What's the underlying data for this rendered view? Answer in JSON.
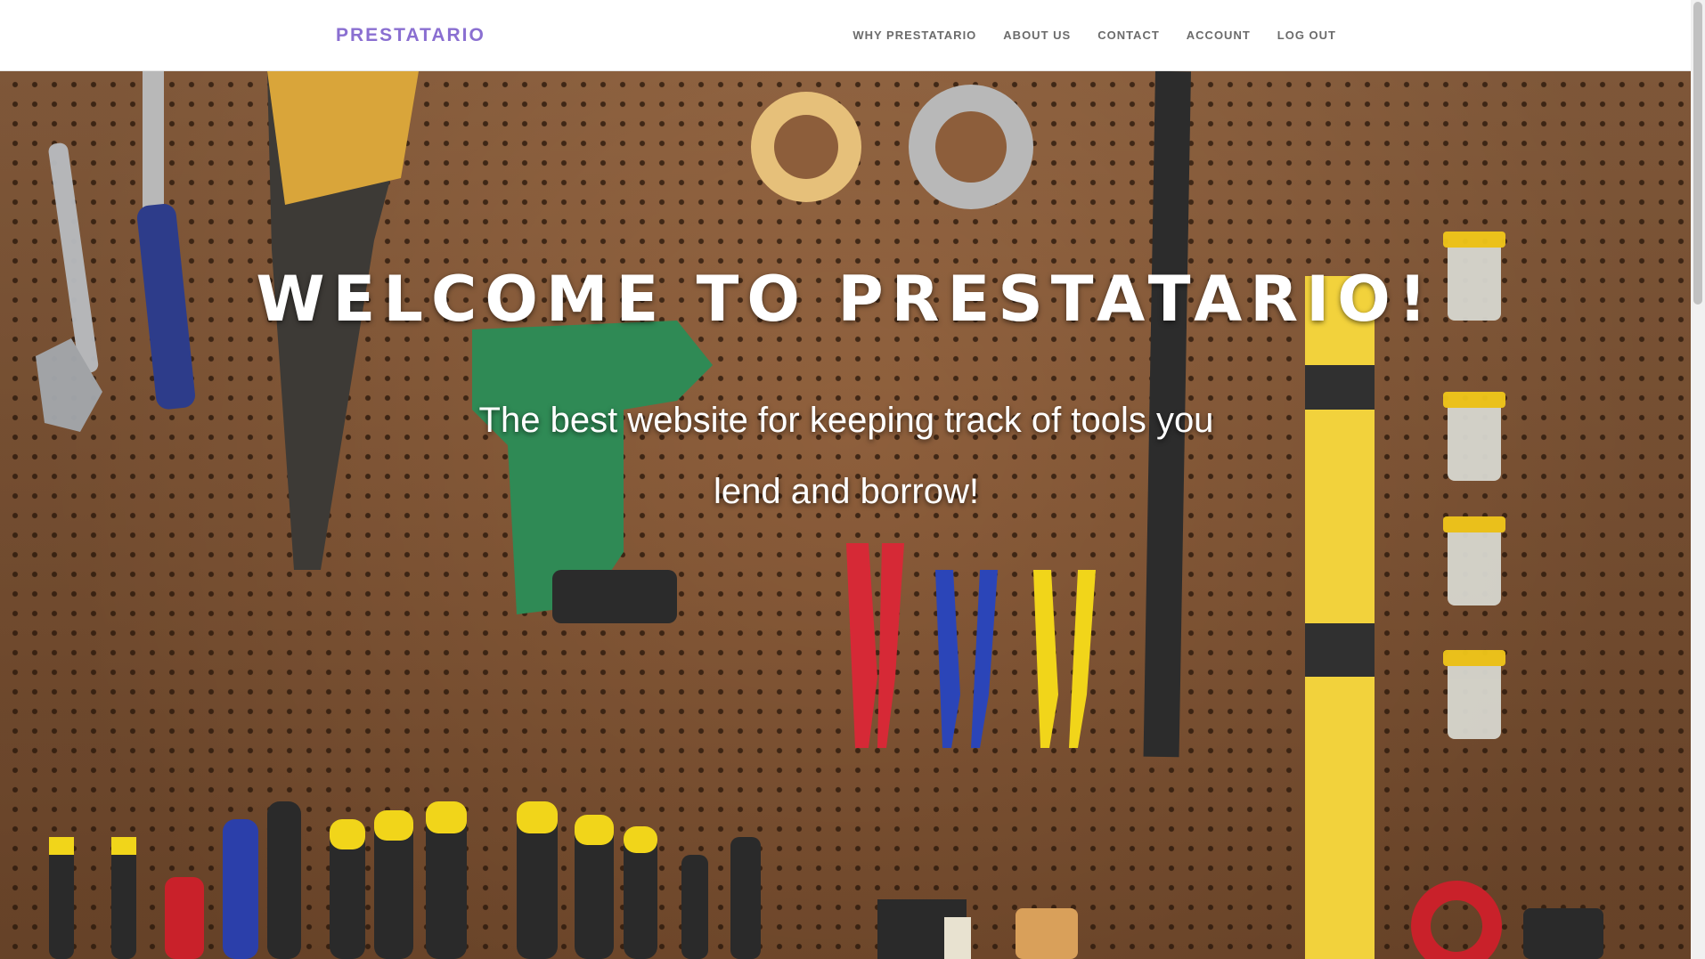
{
  "navbar": {
    "brand": "PRESTATARIO",
    "links": [
      {
        "label": "WHY PRESTATARIO"
      },
      {
        "label": "ABOUT US"
      },
      {
        "label": "CONTACT"
      },
      {
        "label": "ACCOUNT"
      },
      {
        "label": "LOG OUT"
      }
    ]
  },
  "hero": {
    "title": "WELCOME TO PRESTATARIO!",
    "subtitle": "The best website for keeping track of tools you lend and borrow!",
    "background_image": "tools hanging on pegboard"
  },
  "colors": {
    "brand": "#8a6fd1",
    "nav_text": "#6b6b6b",
    "hero_text": "#ffffff"
  }
}
